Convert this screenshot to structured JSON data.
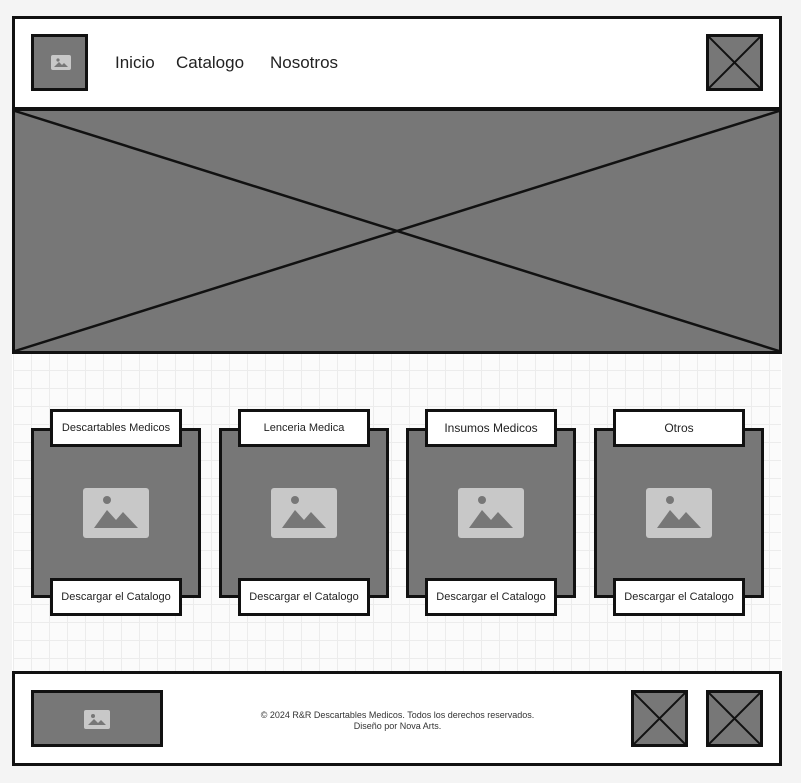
{
  "nav": {
    "logo_icon": "image-icon",
    "items": [
      "Inicio",
      "Catalogo",
      "Nosotros"
    ],
    "menu_icon": "placeholder-x-icon"
  },
  "hero": {
    "icon": "placeholder-x-icon"
  },
  "categories": [
    {
      "title": "Descartables Medicos",
      "button": "Descargar el Catalogo"
    },
    {
      "title": "Lenceria Medica",
      "button": "Descargar el Catalogo"
    },
    {
      "title": "Insumos Medicos",
      "button": "Descargar el Catalogo"
    },
    {
      "title": "Otros",
      "button": "Descargar el Catalogo"
    }
  ],
  "footer": {
    "logo_icon": "image-icon",
    "copyright": "© 2024 R&R Descartables Medicos. Todos los derechos reservados.",
    "credit": "Diseño por Nova Arts.",
    "social_icons": [
      "placeholder-x-icon",
      "placeholder-x-icon"
    ]
  },
  "colors": {
    "placeholder": "#777777",
    "border": "#111111",
    "background": "#ffffff",
    "page": "#f4f4f4"
  }
}
